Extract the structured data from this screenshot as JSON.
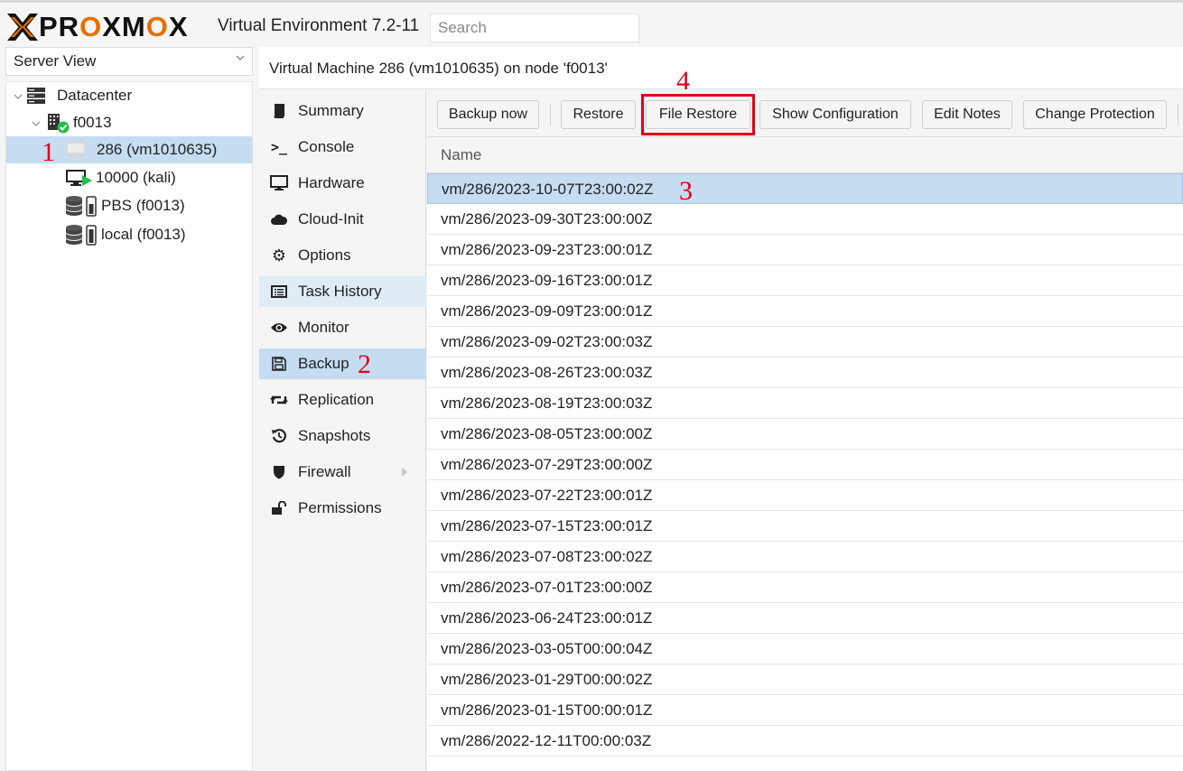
{
  "header": {
    "logo_text_parts": [
      "PR",
      "O",
      "XM",
      "O",
      "X"
    ],
    "version_title": "Virtual Environment 7.2-11",
    "search_placeholder": "Search"
  },
  "tree": {
    "view_label": "Server View",
    "nodes": [
      {
        "label": "Datacenter",
        "icon": "datacenter-icon"
      },
      {
        "label": "f0013",
        "icon": "node-online-icon"
      },
      {
        "label": "286 (vm1010635)",
        "icon": "vm-stopped-icon",
        "selected": true
      },
      {
        "label": "10000 (kali)",
        "icon": "vm-running-icon"
      },
      {
        "label": "PBS (f0013)",
        "icon": "storage-icon"
      },
      {
        "label": "local (f0013)",
        "icon": "storage-icon"
      }
    ]
  },
  "content": {
    "title": "Virtual Machine 286 (vm1010635) on node 'f0013'"
  },
  "menu": {
    "items": [
      {
        "label": "Summary",
        "icon": "book-icon"
      },
      {
        "label": "Console",
        "icon": "terminal-icon"
      },
      {
        "label": "Hardware",
        "icon": "desktop-icon"
      },
      {
        "label": "Cloud-Init",
        "icon": "cloud-icon"
      },
      {
        "label": "Options",
        "icon": "gear-icon"
      },
      {
        "label": "Task History",
        "icon": "list-icon",
        "hover": true
      },
      {
        "label": "Monitor",
        "icon": "eye-icon"
      },
      {
        "label": "Backup",
        "icon": "floppy-icon",
        "selected": true
      },
      {
        "label": "Replication",
        "icon": "retweet-icon"
      },
      {
        "label": "Snapshots",
        "icon": "history-icon"
      },
      {
        "label": "Firewall",
        "icon": "shield-icon",
        "submenu": true
      },
      {
        "label": "Permissions",
        "icon": "unlock-icon"
      }
    ]
  },
  "toolbar": {
    "buttons": [
      "Backup now",
      "Restore",
      "File Restore",
      "Show Configuration",
      "Edit Notes",
      "Change Protection"
    ]
  },
  "grid": {
    "column_name": "Name",
    "selected_index": 0,
    "rows": [
      "vm/286/2023-10-07T23:00:02Z",
      "vm/286/2023-09-30T23:00:00Z",
      "vm/286/2023-09-23T23:00:01Z",
      "vm/286/2023-09-16T23:00:01Z",
      "vm/286/2023-09-09T23:00:01Z",
      "vm/286/2023-09-02T23:00:03Z",
      "vm/286/2023-08-26T23:00:03Z",
      "vm/286/2023-08-19T23:00:03Z",
      "vm/286/2023-08-05T23:00:00Z",
      "vm/286/2023-07-29T23:00:00Z",
      "vm/286/2023-07-22T23:00:01Z",
      "vm/286/2023-07-15T23:00:01Z",
      "vm/286/2023-07-08T23:00:02Z",
      "vm/286/2023-07-01T23:00:00Z",
      "vm/286/2023-06-24T23:00:01Z",
      "vm/286/2023-03-05T00:00:04Z",
      "vm/286/2023-01-29T00:00:02Z",
      "vm/286/2023-01-15T00:00:01Z",
      "vm/286/2022-12-11T00:00:03Z"
    ]
  },
  "annotations": [
    "1",
    "2",
    "3",
    "4"
  ],
  "colors": {
    "brand_orange": "#e57000",
    "selection": "#c5dcf1",
    "annotation_red": "#e0001a"
  }
}
